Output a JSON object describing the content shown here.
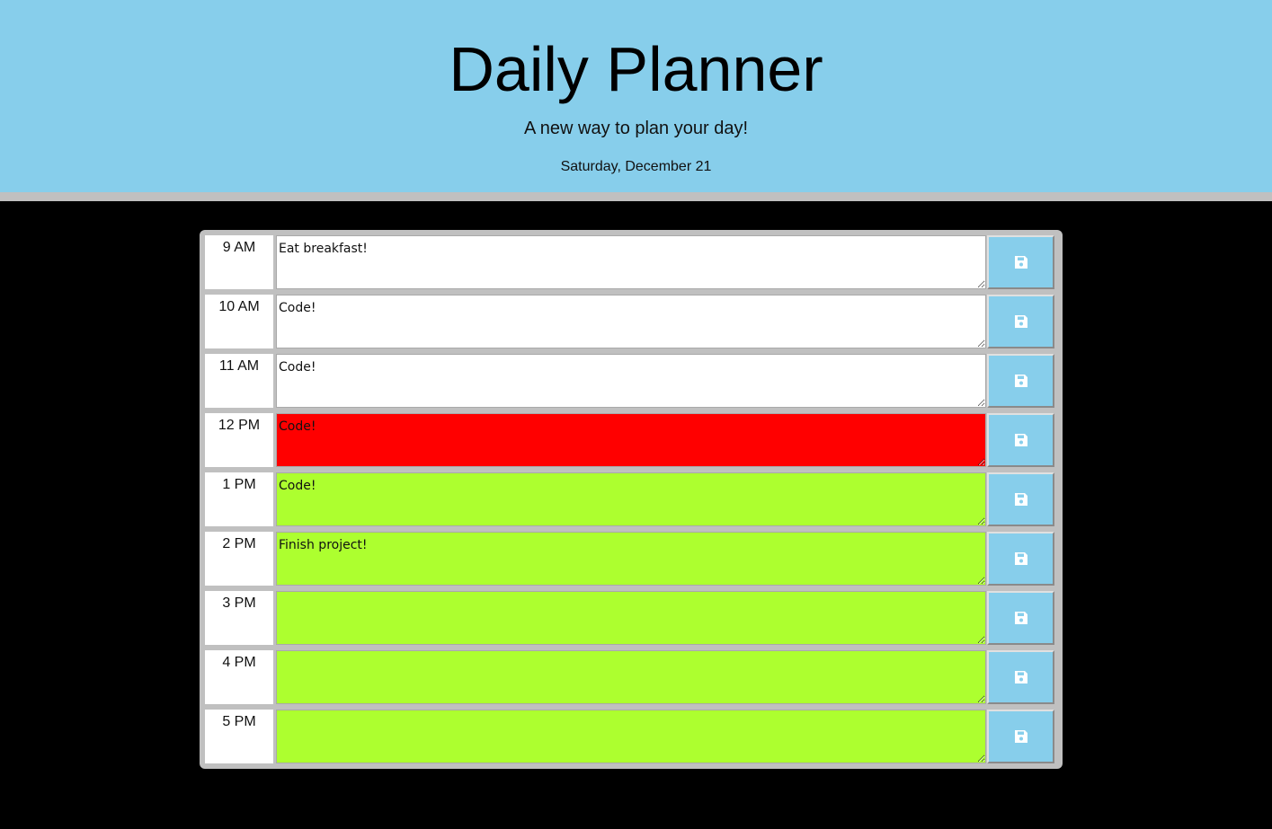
{
  "header": {
    "title": "Daily Planner",
    "subtitle": "A new way to plan your day!",
    "date": "Saturday, December 21"
  },
  "colors": {
    "header_bg": "#87ceeb",
    "past": "#ffffff",
    "present": "#ff0000",
    "future": "#adff2f",
    "save_button": "#87ceeb"
  },
  "rows": [
    {
      "hour": "9 AM",
      "task": "Eat breakfast!",
      "status": "past",
      "save_icon": "save-icon"
    },
    {
      "hour": "10 AM",
      "task": "Code!",
      "status": "past",
      "save_icon": "save-icon"
    },
    {
      "hour": "11 AM",
      "task": "Code!",
      "status": "past",
      "save_icon": "save-icon"
    },
    {
      "hour": "12 PM",
      "task": "Code!",
      "status": "present",
      "save_icon": "save-icon"
    },
    {
      "hour": "1 PM",
      "task": "Code!",
      "status": "future",
      "save_icon": "save-icon"
    },
    {
      "hour": "2 PM",
      "task": "Finish project!",
      "status": "future",
      "save_icon": "save-icon"
    },
    {
      "hour": "3 PM",
      "task": "",
      "status": "future",
      "save_icon": "save-icon"
    },
    {
      "hour": "4 PM",
      "task": "",
      "status": "future",
      "save_icon": "save-icon"
    },
    {
      "hour": "5 PM",
      "task": "",
      "status": "future",
      "save_icon": "save-icon"
    }
  ]
}
